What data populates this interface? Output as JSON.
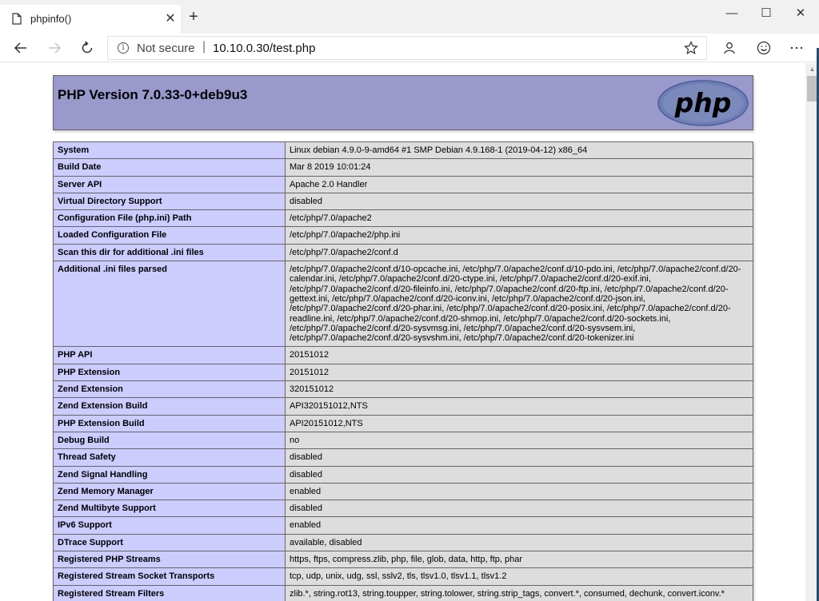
{
  "browser": {
    "tab_title": "phpinfo()",
    "new_tab_label": "+",
    "close_tab_label": "✕",
    "window_controls": {
      "minimize": "—",
      "maximize": "☐",
      "close": "✕"
    },
    "address": {
      "security_label": "Not secure",
      "separator": "|",
      "url": "10.10.0.30/test.php"
    },
    "icons": {
      "back": "arrow-left-icon",
      "forward": "arrow-right-icon",
      "refresh": "refresh-icon",
      "favorite": "star-icon",
      "profile": "person-icon",
      "feedback": "smiley-icon",
      "menu": "more-icon"
    }
  },
  "page": {
    "header_title": "PHP Version 7.0.33-0+deb9u3",
    "logo_text": "php",
    "rows": [
      {
        "key": "System",
        "value": "Linux debian 4.9.0-9-amd64 #1 SMP Debian 4.9.168-1 (2019-04-12) x86_64"
      },
      {
        "key": "Build Date",
        "value": "Mar 8 2019 10:01:24"
      },
      {
        "key": "Server API",
        "value": "Apache 2.0 Handler"
      },
      {
        "key": "Virtual Directory Support",
        "value": "disabled"
      },
      {
        "key": "Configuration File (php.ini) Path",
        "value": "/etc/php/7.0/apache2"
      },
      {
        "key": "Loaded Configuration File",
        "value": "/etc/php/7.0/apache2/php.ini"
      },
      {
        "key": "Scan this dir for additional .ini files",
        "value": "/etc/php/7.0/apache2/conf.d"
      },
      {
        "key": "Additional .ini files parsed",
        "value": "/etc/php/7.0/apache2/conf.d/10-opcache.ini, /etc/php/7.0/apache2/conf.d/10-pdo.ini, /etc/php/7.0/apache2/conf.d/20-calendar.ini, /etc/php/7.0/apache2/conf.d/20-ctype.ini, /etc/php/7.0/apache2/conf.d/20-exif.ini, /etc/php/7.0/apache2/conf.d/20-fileinfo.ini, /etc/php/7.0/apache2/conf.d/20-ftp.ini, /etc/php/7.0/apache2/conf.d/20-gettext.ini, /etc/php/7.0/apache2/conf.d/20-iconv.ini, /etc/php/7.0/apache2/conf.d/20-json.ini, /etc/php/7.0/apache2/conf.d/20-phar.ini, /etc/php/7.0/apache2/conf.d/20-posix.ini, /etc/php/7.0/apache2/conf.d/20-readline.ini, /etc/php/7.0/apache2/conf.d/20-shmop.ini, /etc/php/7.0/apache2/conf.d/20-sockets.ini, /etc/php/7.0/apache2/conf.d/20-sysvmsg.ini, /etc/php/7.0/apache2/conf.d/20-sysvsem.ini, /etc/php/7.0/apache2/conf.d/20-sysvshm.ini, /etc/php/7.0/apache2/conf.d/20-tokenizer.ini"
      },
      {
        "key": "PHP API",
        "value": "20151012"
      },
      {
        "key": "PHP Extension",
        "value": "20151012"
      },
      {
        "key": "Zend Extension",
        "value": "320151012"
      },
      {
        "key": "Zend Extension Build",
        "value": "API320151012,NTS"
      },
      {
        "key": "PHP Extension Build",
        "value": "API20151012,NTS"
      },
      {
        "key": "Debug Build",
        "value": "no"
      },
      {
        "key": "Thread Safety",
        "value": "disabled"
      },
      {
        "key": "Zend Signal Handling",
        "value": "disabled"
      },
      {
        "key": "Zend Memory Manager",
        "value": "enabled"
      },
      {
        "key": "Zend Multibyte Support",
        "value": "disabled"
      },
      {
        "key": "IPv6 Support",
        "value": "enabled"
      },
      {
        "key": "DTrace Support",
        "value": "available, disabled"
      },
      {
        "key": "Registered PHP Streams",
        "value": "https, ftps, compress.zlib, php, file, glob, data, http, ftp, phar"
      },
      {
        "key": "Registered Stream Socket Transports",
        "value": "tcp, udp, unix, udg, ssl, sslv2, tls, tlsv1.0, tlsv1.1, tlsv1.2"
      },
      {
        "key": "Registered Stream Filters",
        "value": "zlib.*, string.rot13, string.toupper, string.tolower, string.strip_tags, convert.*, consumed, dechunk, convert.iconv.*"
      }
    ]
  },
  "colors": {
    "header_bg": "#9999cc",
    "key_bg": "#ccccff",
    "value_bg": "#dddddd",
    "border": "#666666"
  }
}
